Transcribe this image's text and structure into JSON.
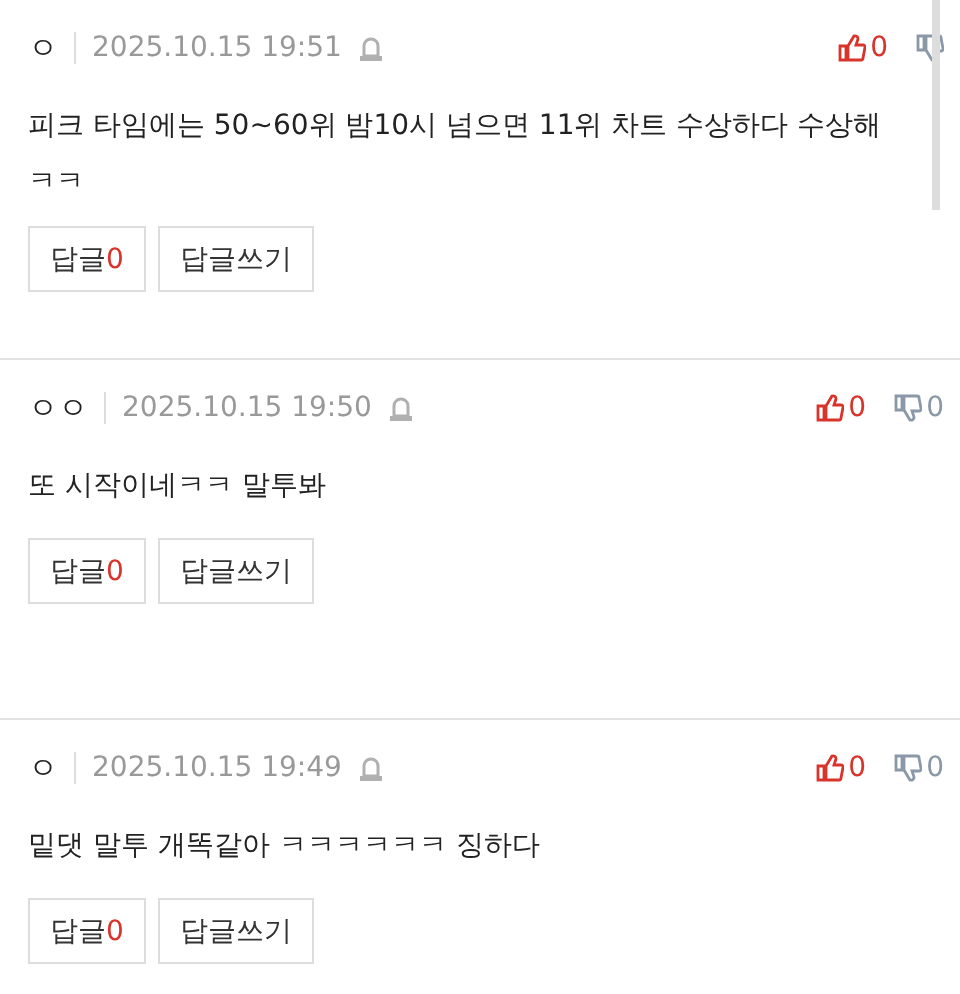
{
  "comments": [
    {
      "author": "ㅇ",
      "date": "2025.10.15 19:51",
      "text": "피크 타임에는 50~60위 밤10시 넘으면 11위 차트 수상하다 수상해 ㅋㅋ",
      "likes": "0",
      "reply_label": "답글",
      "reply_count": "0",
      "write_label": "답글쓰기"
    },
    {
      "author": "ㅇㅇ",
      "date": "2025.10.15 19:50",
      "text": "또 시작이네ㅋㅋ 말투봐",
      "likes": "0",
      "dislikes": "0",
      "reply_label": "답글",
      "reply_count": "0",
      "write_label": "답글쓰기"
    },
    {
      "author": "ㅇ",
      "date": "2025.10.15 19:49",
      "text": "밑댓 말투 개똑같아 ㅋㅋㅋㅋㅋㅋ 징하다",
      "likes": "0",
      "dislikes": "0",
      "reply_label": "답글",
      "reply_count": "0",
      "write_label": "답글쓰기"
    }
  ]
}
